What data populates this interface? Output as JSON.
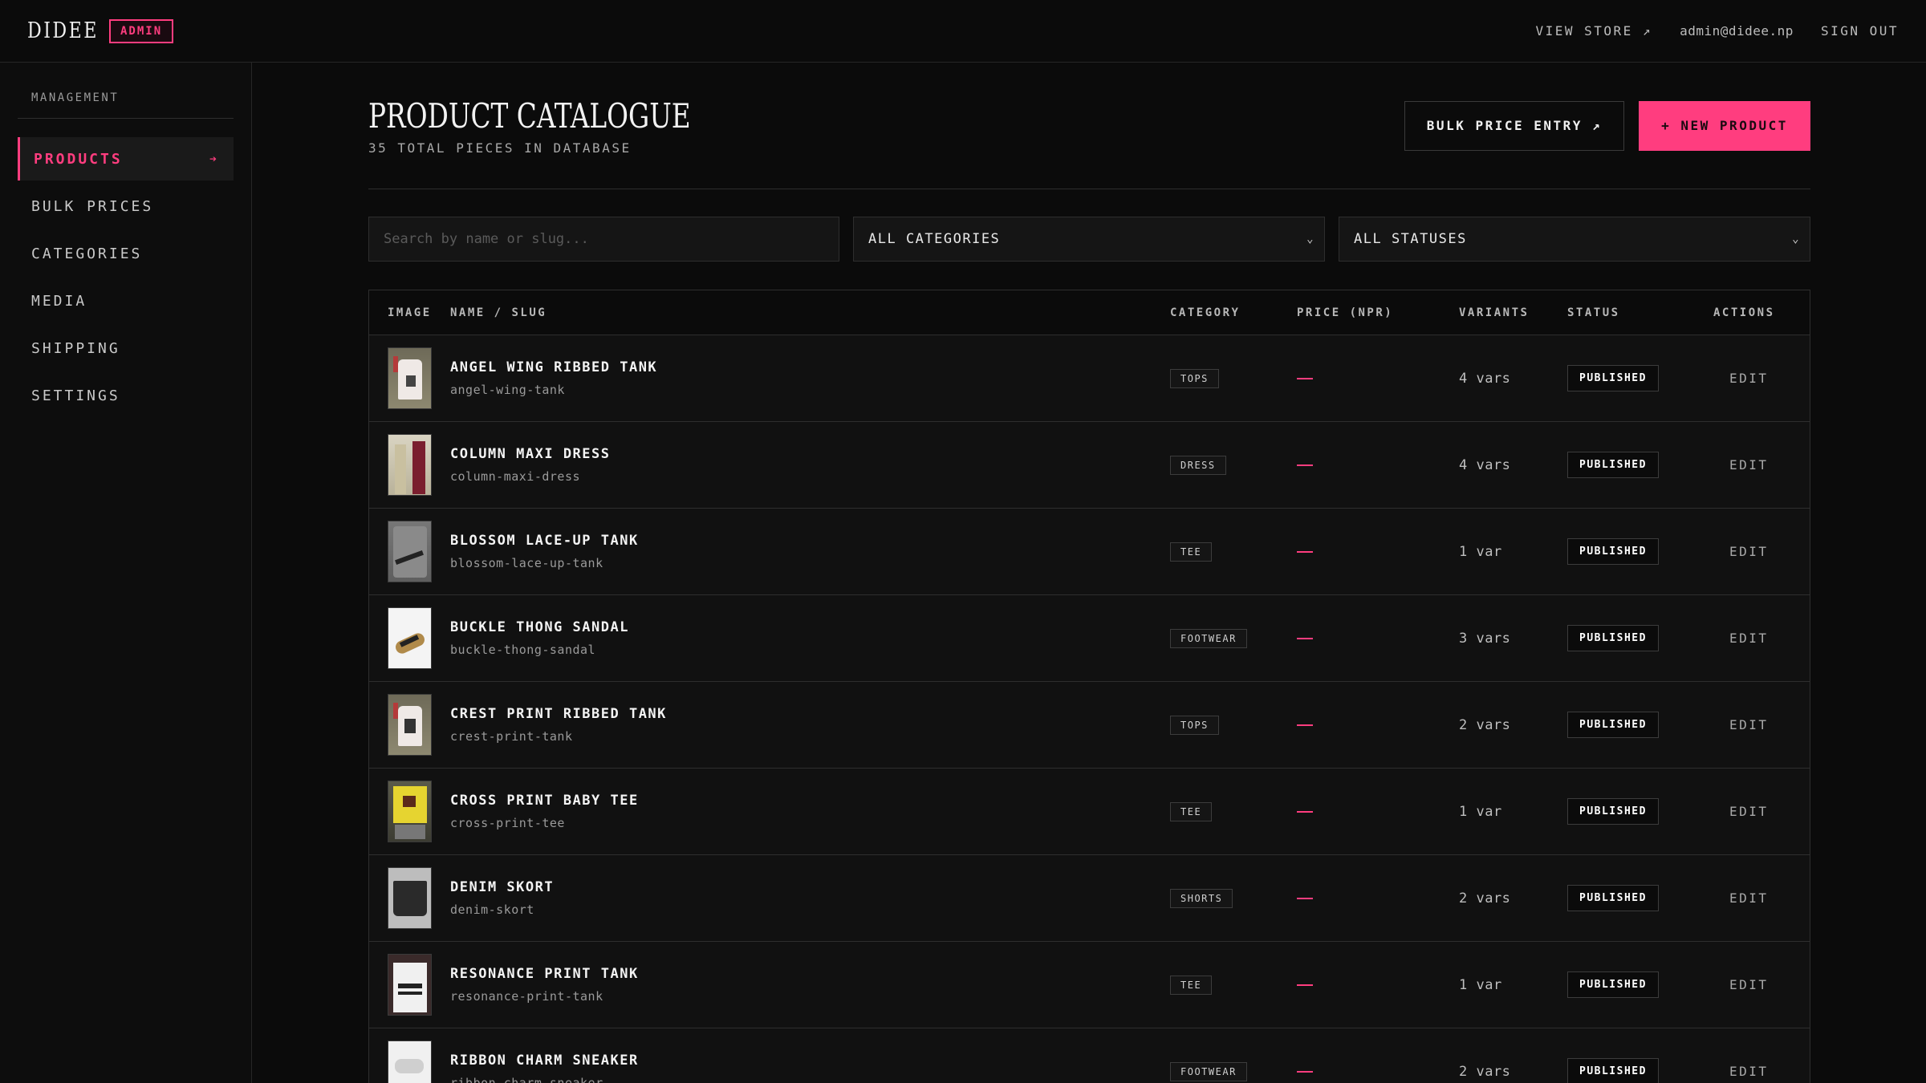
{
  "topbar": {
    "logo": "DIDEE",
    "badge": "ADMIN",
    "view_store": "VIEW STORE ↗",
    "email": "admin@didee.np",
    "sign_out": "SIGN OUT"
  },
  "sidebar": {
    "heading": "MANAGEMENT",
    "items": [
      {
        "label": "PRODUCTS",
        "active": true
      },
      {
        "label": "BULK PRICES"
      },
      {
        "label": "CATEGORIES"
      },
      {
        "label": "MEDIA"
      },
      {
        "label": "SHIPPING"
      },
      {
        "label": "SETTINGS"
      }
    ],
    "active_arrow": "➔"
  },
  "header": {
    "title": "PRODUCT CATALOGUE",
    "subtitle": "35 TOTAL PIECES IN DATABASE",
    "bulk_button": "BULK PRICE ENTRY ↗",
    "new_button": "+ NEW PRODUCT"
  },
  "filters": {
    "search_placeholder": "Search by name or slug...",
    "category_value": "ALL CATEGORIES",
    "status_value": "ALL STATUSES"
  },
  "table": {
    "columns": [
      "IMAGE",
      "NAME / SLUG",
      "CATEGORY",
      "PRICE (NPR)",
      "VARIANTS",
      "STATUS",
      "ACTIONS"
    ],
    "rows": [
      {
        "name": "ANGEL WING RIBBED TANK",
        "slug": "angel-wing-tank",
        "category": "TOPS",
        "price": "—",
        "variants": "4 vars",
        "status": "PUBLISHED",
        "action": "EDIT"
      },
      {
        "name": "COLUMN MAXI DRESS",
        "slug": "column-maxi-dress",
        "category": "DRESS",
        "price": "—",
        "variants": "4 vars",
        "status": "PUBLISHED",
        "action": "EDIT"
      },
      {
        "name": "BLOSSOM LACE-UP TANK",
        "slug": "blossom-lace-up-tank",
        "category": "TEE",
        "price": "—",
        "variants": "1 var",
        "status": "PUBLISHED",
        "action": "EDIT"
      },
      {
        "name": "BUCKLE THONG SANDAL",
        "slug": "buckle-thong-sandal",
        "category": "FOOTWEAR",
        "price": "—",
        "variants": "3 vars",
        "status": "PUBLISHED",
        "action": "EDIT"
      },
      {
        "name": "CREST PRINT RIBBED TANK",
        "slug": "crest-print-tank",
        "category": "TOPS",
        "price": "—",
        "variants": "2 vars",
        "status": "PUBLISHED",
        "action": "EDIT"
      },
      {
        "name": "CROSS PRINT BABY TEE",
        "slug": "cross-print-tee",
        "category": "TEE",
        "price": "—",
        "variants": "1 var",
        "status": "PUBLISHED",
        "action": "EDIT"
      },
      {
        "name": "DENIM SKORT",
        "slug": "denim-skort",
        "category": "SHORTS",
        "price": "—",
        "variants": "2 vars",
        "status": "PUBLISHED",
        "action": "EDIT"
      },
      {
        "name": "RESONANCE PRINT TANK",
        "slug": "resonance-print-tank",
        "category": "TEE",
        "price": "—",
        "variants": "1 var",
        "status": "PUBLISHED",
        "action": "EDIT"
      },
      {
        "name": "RIBBON CHARM SNEAKER",
        "slug": "ribbon-charm-sneaker",
        "category": "FOOTWEAR",
        "price": "—",
        "variants": "2 vars",
        "status": "PUBLISHED",
        "action": "EDIT"
      }
    ]
  },
  "colors": {
    "accent": "#ff3d7f",
    "background": "#0b0b0b",
    "row_background": "#111111",
    "border": "#2e2e2e"
  }
}
